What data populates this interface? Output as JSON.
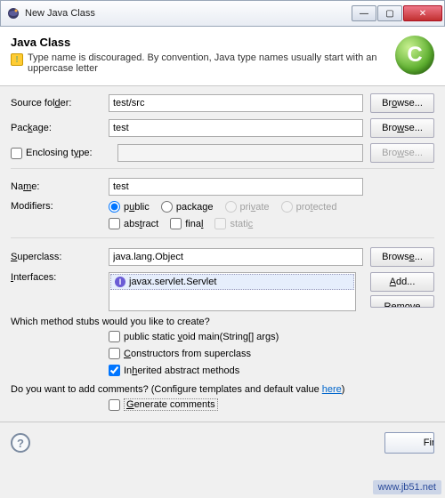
{
  "window": {
    "title": "New Java Class"
  },
  "banner": {
    "heading": "Java Class",
    "warning": "Type name is discouraged. By convention, Java type names usually start with an uppercase letter",
    "badge": "C"
  },
  "fields": {
    "source_folder": {
      "label": "Source folder:",
      "value": "test/src",
      "browse": "Browse..."
    },
    "package": {
      "label": "Package:",
      "value": "test",
      "browse": "Browse..."
    },
    "enclosing": {
      "label": "Enclosing type:",
      "value": "",
      "browse": "Browse..."
    },
    "name": {
      "label": "Name:",
      "value": "test"
    },
    "modifiers": {
      "label": "Modifiers:",
      "public": "public",
      "package": "package",
      "private": "private",
      "protected": "protected",
      "abstract": "abstract",
      "final": "final",
      "static": "static"
    },
    "superclass": {
      "label": "Superclass:",
      "value": "java.lang.Object",
      "browse": "Browse..."
    },
    "interfaces": {
      "label": "Interfaces:",
      "item": "javax.servlet.Servlet",
      "add": "Add...",
      "remove": "Remove"
    }
  },
  "stubs": {
    "question": "Which method stubs would you like to create?",
    "main": "public static void main(String[] args)",
    "ctors": "Constructors from superclass",
    "inherited": "Inherited abstract methods"
  },
  "comments": {
    "question_pre": "Do you want to add comments? (Configure templates and default value ",
    "here": "here",
    "question_post": ")",
    "generate": "Generate comments"
  },
  "footer": {
    "finish": "Finish",
    "watermark": "www.jb51.net"
  }
}
